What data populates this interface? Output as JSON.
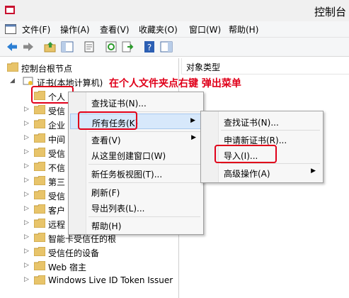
{
  "window": {
    "title": "控制台"
  },
  "menubar": [
    "文件(F)",
    "操作(A)",
    "查看(V)",
    "收藏夹(O)",
    "窗口(W)",
    "帮助(H)"
  ],
  "toolbar": {
    "icons": [
      "back-arrow-icon",
      "forward-arrow-icon",
      "up-folder-icon",
      "show-hide-tree-icon",
      "properties-icon",
      "refresh-icon",
      "export-list-icon",
      "help-icon",
      "show-hide-action-pane-icon"
    ]
  },
  "tree": {
    "root": "控制台根节点",
    "cert_store": "证书(本地计算机)",
    "items": [
      "个人",
      "受信",
      "企业",
      "中间",
      "受信",
      "不信",
      "第三",
      "受信",
      "客户",
      "远程",
      "智能卡受信任的根",
      "受信任的设备",
      "Web 宿主",
      "Windows Live ID Token Issuer"
    ]
  },
  "right_pane": {
    "column_header": "对象类型"
  },
  "annotation": "在个人文件夹点右键 弹出菜单",
  "context_menu": {
    "items": [
      "查找证书(N)...",
      "所有任务(K)",
      "查看(V)",
      "从这里创建窗口(W)",
      "新任务板视图(T)...",
      "刷新(F)",
      "导出列表(L)...",
      "帮助(H)"
    ]
  },
  "submenu": {
    "items": [
      "查找证书(N)...",
      "申请新证书(R)...",
      "导入(I)...",
      "高级操作(A)"
    ]
  },
  "colors": {
    "annotation": "#e0001a",
    "folder": "#e8c46a",
    "highlight": "#d7e8fb"
  }
}
